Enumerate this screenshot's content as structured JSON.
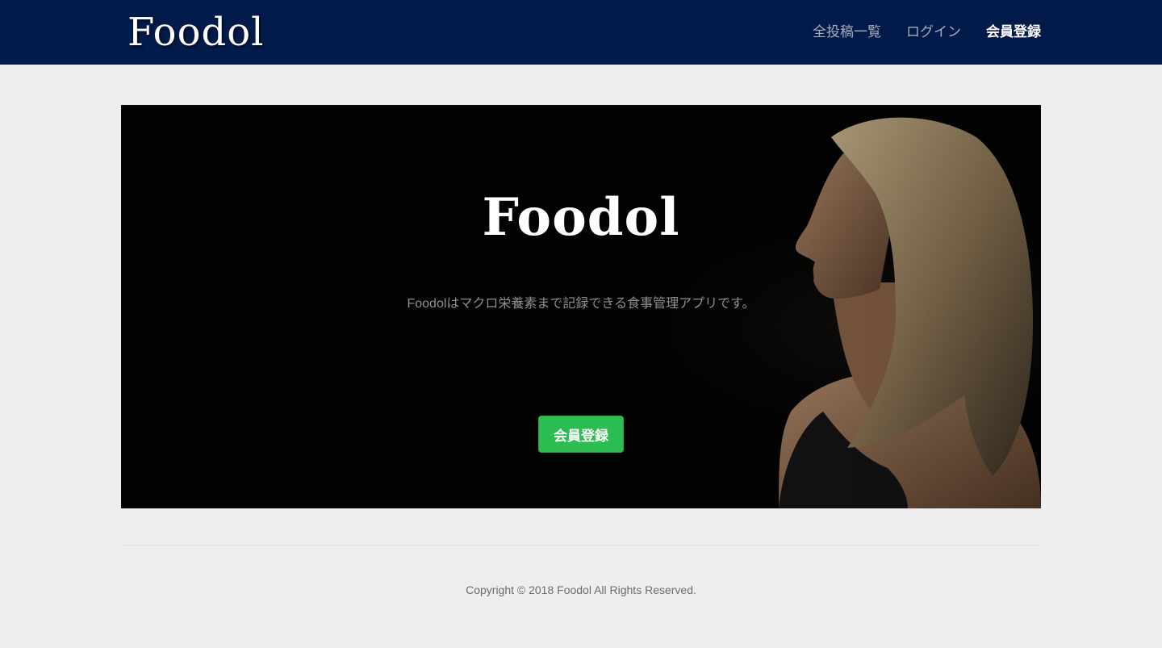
{
  "header": {
    "brand": "Foodol",
    "nav": [
      {
        "label": "全投稿一覧"
      },
      {
        "label": "ログイン"
      },
      {
        "label": "会員登録"
      }
    ]
  },
  "hero": {
    "title": "Foodol",
    "subtitle": "Foodolはマクロ栄養素まで記録できる食事管理アプリです。",
    "cta_label": "会員登録"
  },
  "footer": {
    "copyright": "Copyright © 2018 Foodol All Rights Reserved."
  },
  "colors": {
    "navbar": "#021b4b",
    "page_bg": "#eeeeee",
    "cta": "#2cbd51"
  }
}
